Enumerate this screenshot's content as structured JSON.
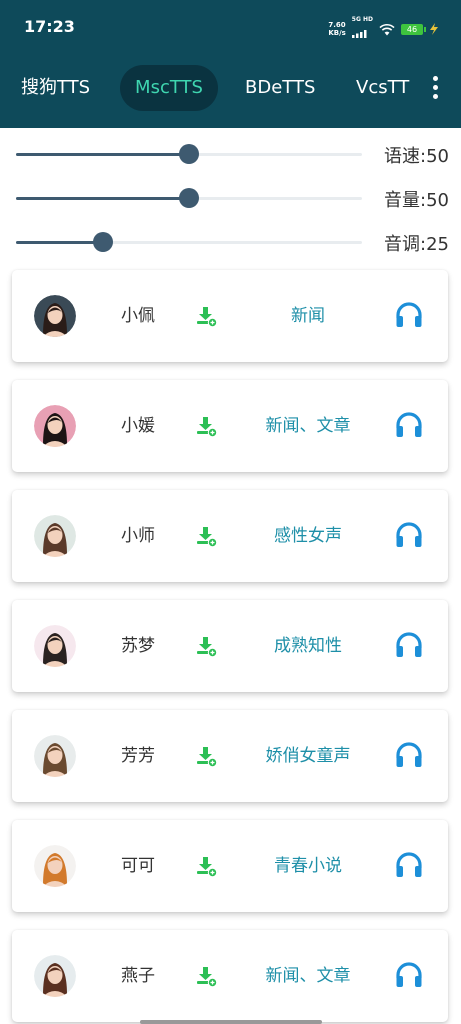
{
  "status": {
    "time": "17:23",
    "net_speed": "7.60",
    "net_unit": "KB/s",
    "signal_label": "5G HD",
    "battery": "46"
  },
  "tabs": [
    {
      "label": "搜狗TTS",
      "active": false
    },
    {
      "label": "MscTTS",
      "active": true
    },
    {
      "label": "BDeTTS",
      "active": false
    },
    {
      "label": "VcsTT",
      "active": false
    }
  ],
  "more_menu": "more-vert-icon",
  "sliders": [
    {
      "label": "语速:50",
      "level": 0.5
    },
    {
      "label": "音量:50",
      "level": 0.5
    },
    {
      "label": "音调:25",
      "level": 0.25
    }
  ],
  "voices": [
    {
      "name": "小佩",
      "tags": "新闻"
    },
    {
      "name": "小媛",
      "tags": "新闻、文章"
    },
    {
      "name": "小师",
      "tags": "感性女声"
    },
    {
      "name": "苏梦",
      "tags": "成熟知性"
    },
    {
      "name": "芳芳",
      "tags": "娇俏女童声"
    },
    {
      "name": "可可",
      "tags": "青春小说"
    },
    {
      "name": "燕子",
      "tags": "新闻、文章"
    }
  ],
  "colors": {
    "header": "#0e4a5a",
    "active_tab_text": "#3fd6b0",
    "slider": "#3e5a70",
    "download": "#2cbf55",
    "tag_text": "#1e8fa8",
    "headphones": "#1d8fd8"
  }
}
